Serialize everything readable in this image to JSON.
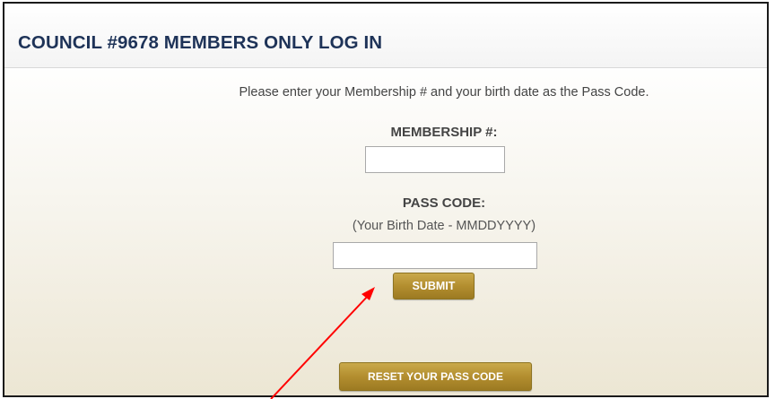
{
  "header": {
    "title": "COUNCIL #9678 MEMBERS ONLY LOG IN"
  },
  "login": {
    "instructions": "Please enter your Membership # and your birth date as the Pass Code.",
    "membership_label": "MEMBERSHIP #:",
    "membership_value": "",
    "passcode_label": "PASS CODE:",
    "passcode_hint": "(Your Birth Date - MMDDYYYY)",
    "passcode_value": "",
    "submit_label": "SUBMIT",
    "reset_label": "RESET YOUR PASS CODE"
  },
  "annotation": {
    "arrow_color": "#ff0000",
    "arrow_target": "submit-button"
  },
  "colors": {
    "title": "#1e3358",
    "button_gold": "#b38e2f"
  }
}
